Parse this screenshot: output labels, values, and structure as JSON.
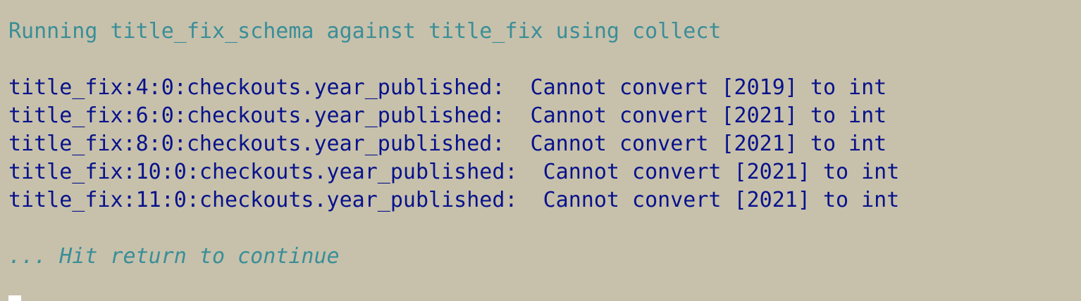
{
  "terminal": {
    "header": "Running title_fix_schema against title_fix using collect",
    "errors": [
      "title_fix:4:0:checkouts.year_published:  Cannot convert [2019] to int",
      "title_fix:6:0:checkouts.year_published:  Cannot convert [2021] to int",
      "title_fix:8:0:checkouts.year_published:  Cannot convert [2021] to int",
      "title_fix:10:0:checkouts.year_published:  Cannot convert [2021] to int",
      "title_fix:11:0:checkouts.year_published:  Cannot convert [2021] to int"
    ],
    "prompt": "... Hit return to continue"
  },
  "colors": {
    "background": "#c7c1ab",
    "header_text": "#3a8e98",
    "error_text": "#08128c",
    "prompt_text": "#3a8e98"
  }
}
